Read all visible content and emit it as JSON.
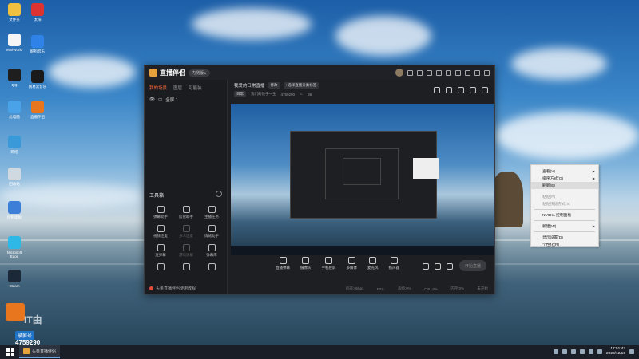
{
  "desktop": {
    "icons_left": [
      {
        "label": "文件夹",
        "icon": "folder-icon",
        "color": "#f0c040"
      },
      {
        "label": "MiniWorld",
        "icon": "doc-icon",
        "color": "#f5f5f5"
      },
      {
        "label": "QQ",
        "icon": "qq-penguin-icon",
        "color": "#1e1e1e"
      },
      {
        "label": "此电脑",
        "icon": "computer-icon",
        "color": "#4aa3e8"
      },
      {
        "label": "网络",
        "icon": "network-icon",
        "color": "#3a9ad9"
      },
      {
        "label": "回收站",
        "icon": "recycle-bin-icon",
        "color": "#d0d8e0"
      },
      {
        "label": "控制面板",
        "icon": "control-panel-icon",
        "color": "#3d7ed8"
      },
      {
        "label": "Microsoft Edge",
        "icon": "edge-icon",
        "color": "#2db8e6"
      },
      {
        "label": "Steam",
        "icon": "steam-icon",
        "color": "#1b2838"
      }
    ],
    "icons_right": [
      {
        "label": "太阳",
        "icon": "sun-app-icon",
        "color": "#d33"
      },
      {
        "label": "酷狗音乐",
        "icon": "kugou-icon",
        "color": "#2f83e8"
      },
      {
        "label": "网易云音乐",
        "icon": "music-icon",
        "color": "#1a1a1a"
      },
      {
        "label": "直播伴侣",
        "icon": "live-app-icon",
        "color": "#e8761f"
      }
    ]
  },
  "window": {
    "app_name": "直播伴侣",
    "version_badge": "内测版 ▸",
    "left_tabs": [
      "我的场景",
      "图层",
      "可能装"
    ],
    "scene_label": "全屏 1",
    "tools_title": "工具箱",
    "tools": [
      {
        "label": "弹幕助手",
        "dim": false
      },
      {
        "label": "房管助手",
        "dim": false
      },
      {
        "label": "主播任务",
        "dim": false
      },
      {
        "label": "视频连麦",
        "dim": false
      },
      {
        "label": "多人连麦",
        "dim": true
      },
      {
        "label": "情绪助手",
        "dim": false
      },
      {
        "label": "连弹幕",
        "dim": false
      },
      {
        "label": "游戏讲解",
        "dim": true
      },
      {
        "label": "弹幕库",
        "dim": false
      },
      {
        "label": "",
        "dim": false
      },
      {
        "label": "",
        "dim": false
      },
      {
        "label": "",
        "dim": false
      }
    ],
    "left_footer": "头条直播伴侣使用教程",
    "live_title": "我爱的日常直播",
    "live_title_chip": "修改",
    "live_title_chip2": "+选择直播分类标签",
    "live_sub_category": "日常",
    "live_sub_id_label": "我们的快手一生",
    "live_sub_id": "4759290",
    "live_sub_fire": "36",
    "controls": [
      "直播弹幕",
      "摄像头",
      "手机投屏",
      "多媒体",
      "麦克风",
      "扬声器"
    ],
    "start_label": "开始直播",
    "status": [
      "码率:0kbps",
      "FPS:",
      "丢帧:0%",
      "CPU:0%",
      "内存:0%",
      "未开始"
    ]
  },
  "context_menu": {
    "items": [
      {
        "label": "查看(V)",
        "arrow": true,
        "disabled": false,
        "hover": false
      },
      {
        "label": "排序方式(O)",
        "arrow": true,
        "disabled": false,
        "hover": false
      },
      {
        "label": "刷新(E)",
        "arrow": false,
        "disabled": false,
        "hover": true
      },
      {
        "sep": true
      },
      {
        "label": "粘贴(P)",
        "arrow": false,
        "disabled": true,
        "hover": false
      },
      {
        "label": "粘贴快捷方式(S)",
        "arrow": false,
        "disabled": true,
        "hover": false
      },
      {
        "sep": true
      },
      {
        "label": "NVIDIA 控制面板",
        "arrow": false,
        "disabled": false,
        "hover": false
      },
      {
        "sep": true
      },
      {
        "label": "新建(W)",
        "arrow": true,
        "disabled": false,
        "hover": false
      },
      {
        "sep": true
      },
      {
        "label": "显示设置(D)",
        "arrow": false,
        "disabled": false,
        "hover": false
      },
      {
        "label": "个性化(R)",
        "arrow": false,
        "disabled": false,
        "hover": false
      }
    ]
  },
  "streamer": {
    "name": "IT由",
    "tag": "录屏号",
    "id": "4759290"
  },
  "taskbar": {
    "app_label": "头条直播伴侣",
    "time": "17:51:43",
    "date": "2022/12/10"
  }
}
